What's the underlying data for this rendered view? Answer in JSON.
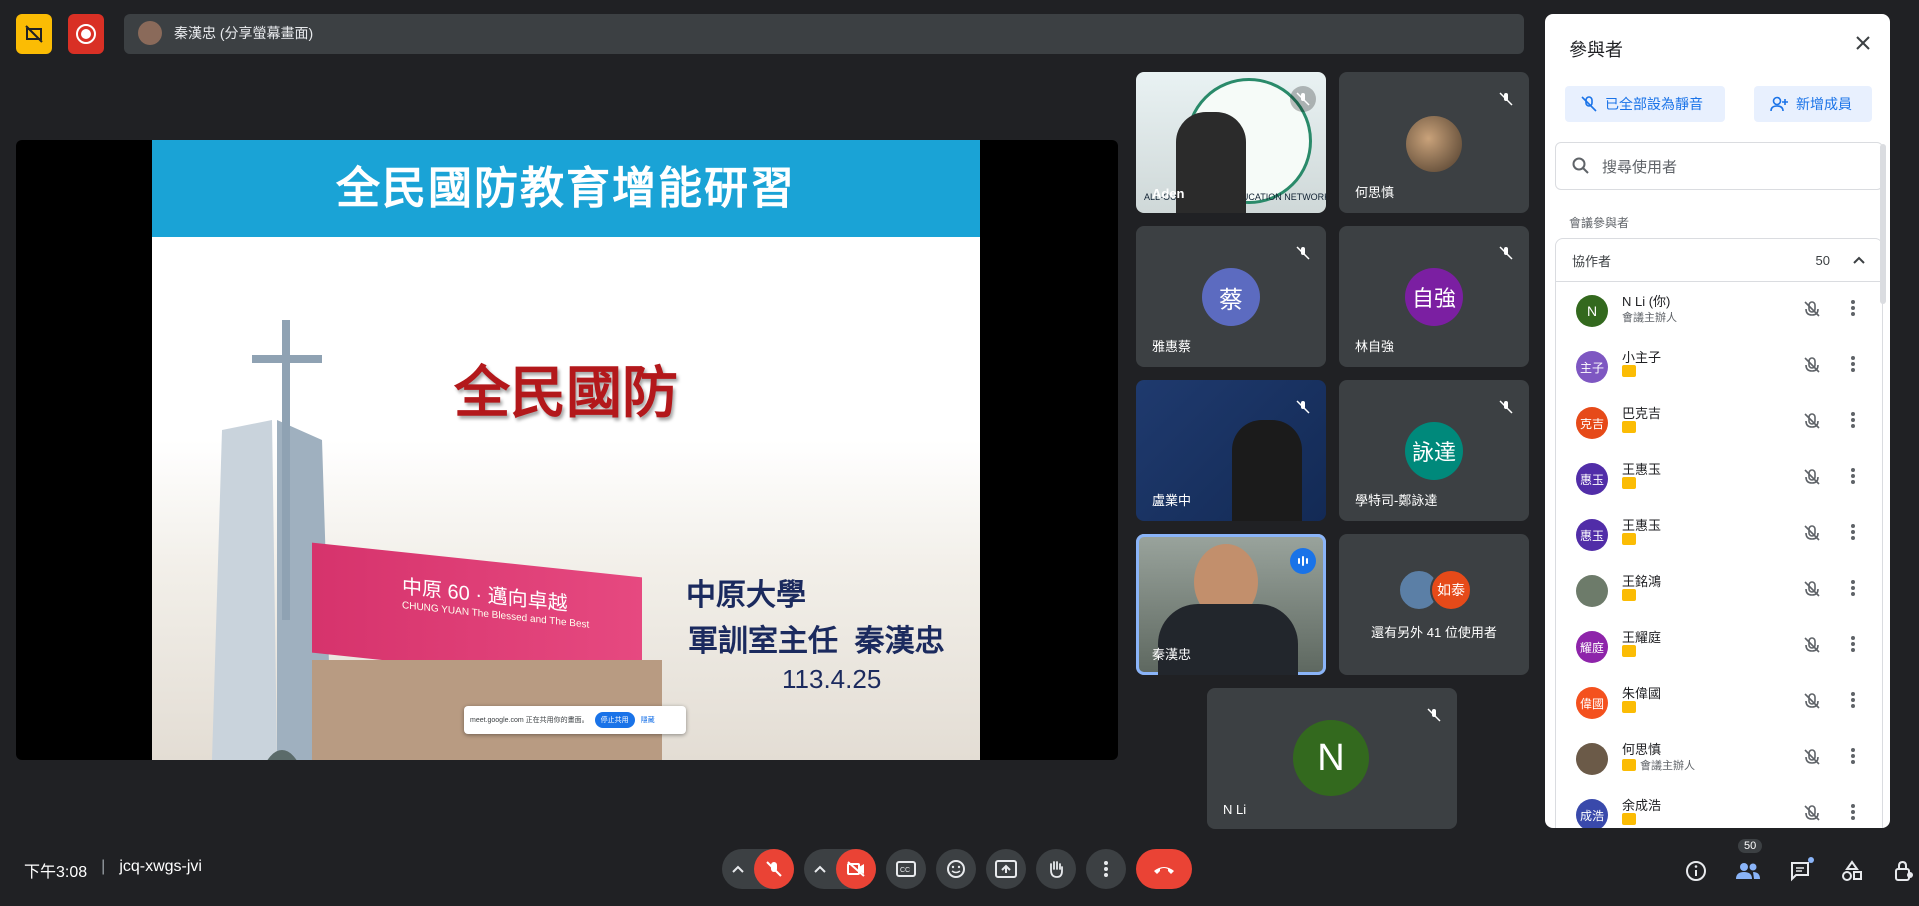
{
  "top": {
    "presenter_label": "秦漢忠 (分享螢幕畫面)"
  },
  "slide": {
    "header": "全民國防教育增能研習",
    "main_title": "全民國防",
    "school": "中原大學",
    "role_name": "軍訓室主任  秦漢忠",
    "date": "113.4.25",
    "building_sign": "中原 60 · 邁向卓越",
    "building_sub": "CHUNG YUAN  The Blessed and The Best",
    "share_text": "meet.google.com 正在共用你的畫面。",
    "share_stop": "停止共用",
    "share_hide": "隱藏"
  },
  "tiles": [
    {
      "name": "Aden",
      "type": "video",
      "video_text": "ALL-OUT DEFENSE EDUCATION NETWORK"
    },
    {
      "name": "何思慎",
      "type": "photo"
    },
    {
      "name": "雅惠蔡",
      "type": "initial",
      "initial": "蔡",
      "color": "#5c6bc0"
    },
    {
      "name": "林自強",
      "type": "initial",
      "initial": "自強",
      "color": "#7b1fa2"
    },
    {
      "name": "盧業中",
      "type": "video"
    },
    {
      "name": "學特司-鄭詠達",
      "type": "initial",
      "initial": "詠達",
      "color": "#00897b"
    },
    {
      "name": "秦漢忠",
      "type": "video"
    },
    {
      "name": "還有另外 41 位使用者",
      "type": "more",
      "more_initial": "如泰"
    },
    {
      "name": "N Li",
      "type": "initial",
      "initial": "N",
      "color": "#33691e"
    }
  ],
  "bottom": {
    "time": "下午3:08",
    "separator": "|",
    "meeting_code": "jcq-xwgs-jvi",
    "people_count": "50"
  },
  "panel": {
    "title": "參與者",
    "mute_all": "已全部設為靜音",
    "add_people": "新增成員",
    "search_placeholder": "搜尋使用者",
    "section_label": "會議參與者",
    "group_label": "協作者",
    "group_count": "50",
    "people": [
      {
        "name": "N Li (你)",
        "sub": "會議主辦人",
        "initial": "N",
        "color": "#33691e",
        "badge": false
      },
      {
        "name": "小主子",
        "sub": "",
        "initial": "主子",
        "color": "#7e57c2",
        "badge": true
      },
      {
        "name": "巴克吉",
        "sub": "",
        "initial": "克吉",
        "color": "#e64a19",
        "badge": true
      },
      {
        "name": "王惠玉",
        "sub": "",
        "initial": "惠玉",
        "color": "#512da8",
        "badge": true
      },
      {
        "name": "王惠玉",
        "sub": "",
        "initial": "惠玉",
        "color": "#512da8",
        "badge": true
      },
      {
        "name": "王銘鴻",
        "sub": "",
        "initial": "",
        "color": "#6d7b6a",
        "badge": true
      },
      {
        "name": "王耀庭",
        "sub": "",
        "initial": "耀庭",
        "color": "#8e24aa",
        "badge": true
      },
      {
        "name": "朱偉國",
        "sub": "",
        "initial": "偉國",
        "color": "#f4511e",
        "badge": true
      },
      {
        "name": "何思慎",
        "sub": "會議主辦人",
        "initial": "",
        "color": "#6b5a48",
        "badge": true
      },
      {
        "name": "余成浩",
        "sub": "",
        "initial": "成浩",
        "color": "#3949ab",
        "badge": true
      }
    ]
  }
}
